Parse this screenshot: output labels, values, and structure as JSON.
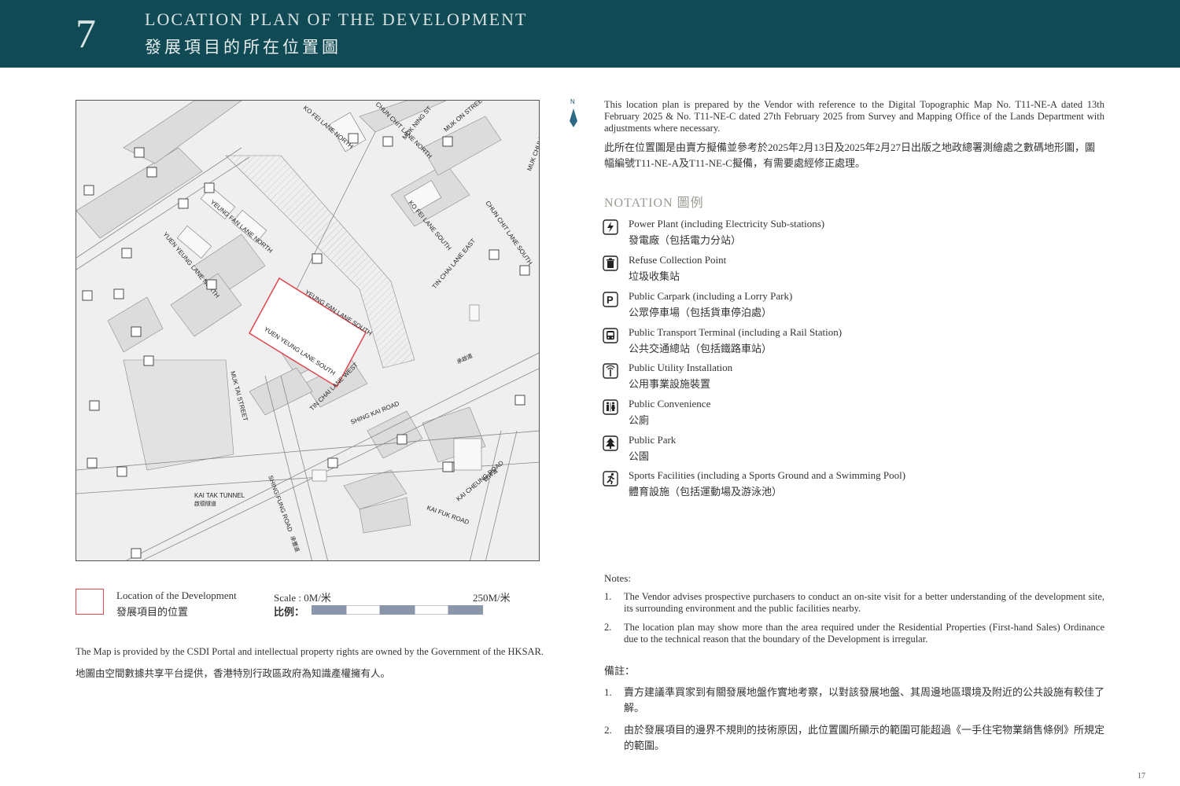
{
  "header": {
    "section_number": "7",
    "title_en": "LOCATION PLAN OF THE DEVELOPMENT",
    "title_zh": "發展項目的所在位置圖"
  },
  "compass": {
    "label": "N"
  },
  "intro": {
    "en": "This location plan is prepared by the Vendor with reference to the Digital Topographic Map No. T11-NE-A dated 13th February 2025 & No. T11-NE-C dated 27th February 2025 from Survey and Mapping Office of the Lands Department with adjustments where necessary.",
    "zh": "此所在位置圖是由賣方擬備並參考於2025年2月13日及2025年2月27日出版之地政總署測繪處之數碼地形圖，圖幅編號T11-NE-A及T11-NE-C擬備，有需要處經修正處理。"
  },
  "notation": {
    "title": "NOTATION 圖例",
    "items": [
      {
        "icon": "power-plant-icon",
        "en": "Power Plant (including Electricity Sub-stations)",
        "zh": "發電廠（包括電力分站）"
      },
      {
        "icon": "refuse-collection-icon",
        "en": "Refuse Collection Point",
        "zh": "垃圾收集站"
      },
      {
        "icon": "public-carpark-icon",
        "en": "Public Carpark (including a Lorry Park)",
        "zh": "公眾停車場（包括貨車停泊處）"
      },
      {
        "icon": "public-transport-icon",
        "en": "Public Transport Terminal (including a Rail Station)",
        "zh": "公共交通總站（包括鐵路車站）"
      },
      {
        "icon": "public-utility-icon",
        "en": "Public Utility Installation",
        "zh": "公用事業設施裝置"
      },
      {
        "icon": "public-convenience-icon",
        "en": "Public Convenience",
        "zh": "公廁"
      },
      {
        "icon": "public-park-icon",
        "en": "Public Park",
        "zh": "公園"
      },
      {
        "icon": "sports-facilities-icon",
        "en": "Sports Facilities (including a Sports Ground and a Swimming Pool)",
        "zh": "體育設施（包括運動場及游泳池）"
      }
    ]
  },
  "map": {
    "streets": {
      "ko_fei_lane_north": "KO FEI LANE NORTH",
      "chun_chit_lane_north": "CHUN CHIT LANE NORTH",
      "muk_ning_st": "MUK NING ST",
      "muk_on_street": "MUK ON STREET",
      "muk_chui_street": "MUK CHUI STREET",
      "yeung_fan_lane_north": "YEUNG FAN LANE NORTH",
      "yuen_yeung_lane_north": "YUEN YEUNG LANE NORTH",
      "ko_fei_lane_south": "KO FEI LANE SOUTH",
      "chun_chit_lane_south": "CHUN CHIT LANE SOUTH",
      "tin_chai_lane_east": "TIN CHAI LANE EAST",
      "yeung_fan_lane_south": "YEUNG FAN LANE SOUTH",
      "yuen_yeung_lane_south": "YUEN YEUNG LANE SOUTH",
      "tin_chai_lane_west": "TIN CHAI LANE WEST",
      "shing_kai_road": "SHING KAI ROAD",
      "muk_tai_street": "MUK TAI STREET",
      "kai_tak_tunnel": "KAI TAK TUNNEL",
      "kai_tak_tunnel_zh": "啟德隧道",
      "shing_fung_road": "SHING FUNG ROAD",
      "shing_fung_road_zh": "承豐道",
      "kai_fuk_road": "KAI FUK ROAD",
      "kai_cheung_road": "KAI CHEUNG ROAD",
      "kai_cheung_road_zh": "啟祥道",
      "shing_kai_road_zh": "承啟道"
    }
  },
  "legend": {
    "location_en": "Location of the Development",
    "location_zh": "發展項目的位置",
    "scale_label": "Scale :  0M/米",
    "scale_label_zh": "比例：",
    "scale_end": "250M/米"
  },
  "credit": {
    "en": "The Map is provided by the CSDI Portal and intellectual property rights are owned by the Government of the HKSAR.",
    "zh": "地圖由空間數據共享平台提供，香港特別行政區政府為知識產權擁有人。"
  },
  "notes": {
    "title": "Notes:",
    "items": [
      {
        "num": "1.",
        "text": "The Vendor advises prospective purchasers to conduct an on-site visit for a better understanding of the development site, its surrounding environment and the public facilities nearby."
      },
      {
        "num": "2.",
        "text": "The location plan may show more than the area required under the Residential Properties (First-hand Sales) Ordinance due to the technical reason that the boundary of the Development is irregular."
      }
    ],
    "title_zh": "備註：",
    "items_zh": [
      {
        "num": "1.",
        "text": "賣方建議準買家到有關發展地盤作實地考察，以對該發展地盤、其周邊地區環境及附近的公共設施有較佳了解。"
      },
      {
        "num": "2.",
        "text": "由於發展項目的邊界不規則的技術原因，此位置圖所顯示的範圍可能超過《一手住宅物業銷售條例》所規定的範圍。"
      }
    ]
  },
  "page_number": "17",
  "colors": {
    "header_bg": "#0f4a55",
    "site_outline": "#e0474d",
    "notation_title": "#9a9a92"
  }
}
